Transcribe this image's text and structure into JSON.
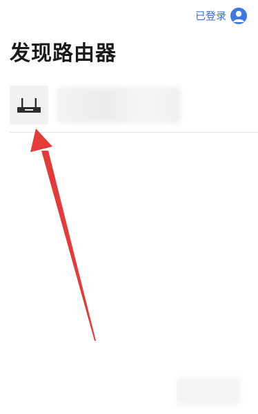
{
  "header": {
    "login_status": "已登录",
    "avatar_icon": "user-avatar-icon",
    "accent_color": "#3b6fd1"
  },
  "main": {
    "title": "发现路由器"
  },
  "device_list": [
    {
      "icon": "router-icon",
      "name_redacted": true
    }
  ],
  "annotation": {
    "arrow_color": "#e53a3a"
  }
}
